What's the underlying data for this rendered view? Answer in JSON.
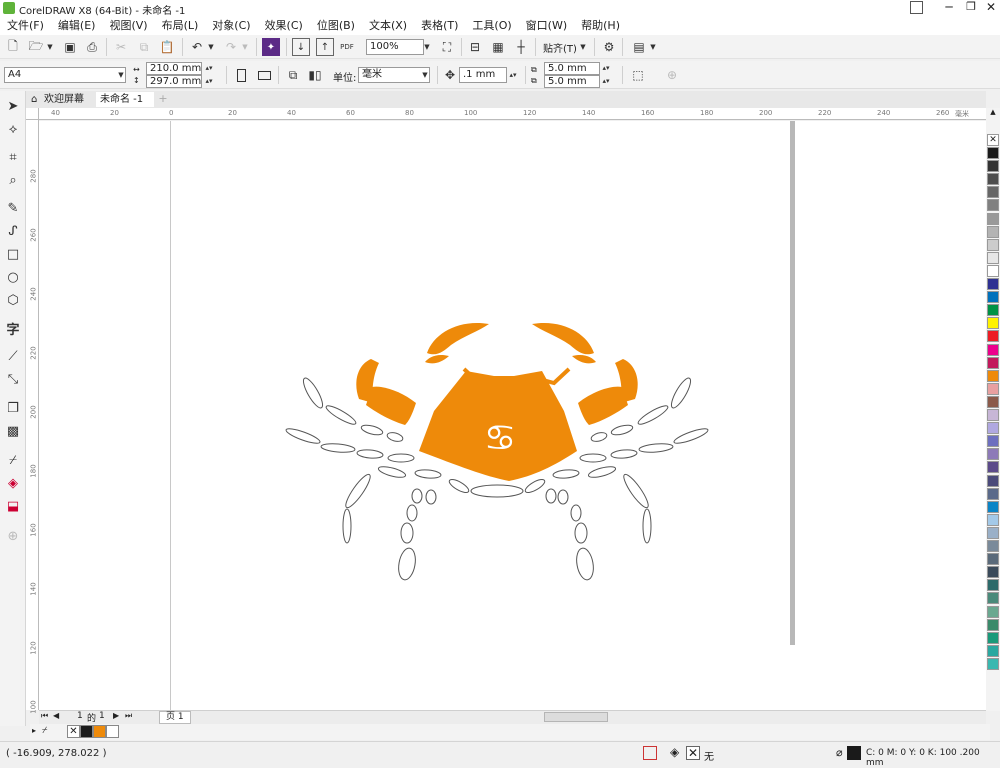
{
  "window": {
    "title": "CorelDRAW X8 (64-Bit) - 未命名 -1"
  },
  "menu": [
    "文件(F)",
    "编辑(E)",
    "视图(V)",
    "布局(L)",
    "对象(C)",
    "效果(C)",
    "位图(B)",
    "文本(X)",
    "表格(T)",
    "工具(O)",
    "窗口(W)",
    "帮助(H)"
  ],
  "toolbar": {
    "zoom_value": "100%",
    "snap_label": "贴齐(T)",
    "pdf_label": "PDF"
  },
  "properties": {
    "page_preset": "A4",
    "width": "210.0 mm",
    "height": "297.0 mm",
    "unit_label": "单位:",
    "unit_value": "毫米",
    "nudge": ".1 mm",
    "dup_x": "5.0 mm",
    "dup_y": "5.0 mm"
  },
  "tabs": {
    "welcome": "欢迎屏幕",
    "document": "未命名 -1"
  },
  "rulers": {
    "h_ticks": [
      "40",
      "20",
      "0",
      "20",
      "40",
      "60",
      "80",
      "100",
      "120",
      "140",
      "160",
      "180",
      "200",
      "220",
      "240",
      "260",
      "毫米"
    ],
    "v_ticks": [
      "280",
      "260",
      "240",
      "220",
      "200",
      "180",
      "160",
      "140",
      "120",
      "100"
    ]
  },
  "page_nav": {
    "current": "1",
    "of": "的",
    "total": "1",
    "page_tab": "页 1"
  },
  "status": {
    "coords": "( -16.909, 278.022 )",
    "fill_label": "无",
    "outline_info": "C: 0 M: 0 Y: 0 K: 100  .200 mm"
  },
  "colors": {
    "accent": "#ee8a0a",
    "palette": [
      "#1a1a1a",
      "#333333",
      "#4d4d4d",
      "#666666",
      "#808080",
      "#999999",
      "#b3b3b3",
      "#cccccc",
      "#e6e6e6",
      "#ffffff",
      "#2e3192",
      "#0071bc",
      "#009245",
      "#fff200",
      "#ed1c24",
      "#ec008c",
      "#c2185b",
      "#ee8a0a",
      "#e8a0a0",
      "#8b5a4a",
      "#c7b6d6",
      "#b0a8e0",
      "#6d6fbf",
      "#8d7ab8",
      "#5b4a8a",
      "#4a4a7a",
      "#5a6a8a",
      "#0a84c6",
      "#a3c9e8",
      "#9ab0c8",
      "#7a8a9a",
      "#5a6a7a",
      "#3a4a5a",
      "#2d6a6a",
      "#4a8a7a",
      "#6aa890",
      "#3a8a6a",
      "#1a9a7a",
      "#2aa8a0",
      "#3ab8b0"
    ]
  }
}
